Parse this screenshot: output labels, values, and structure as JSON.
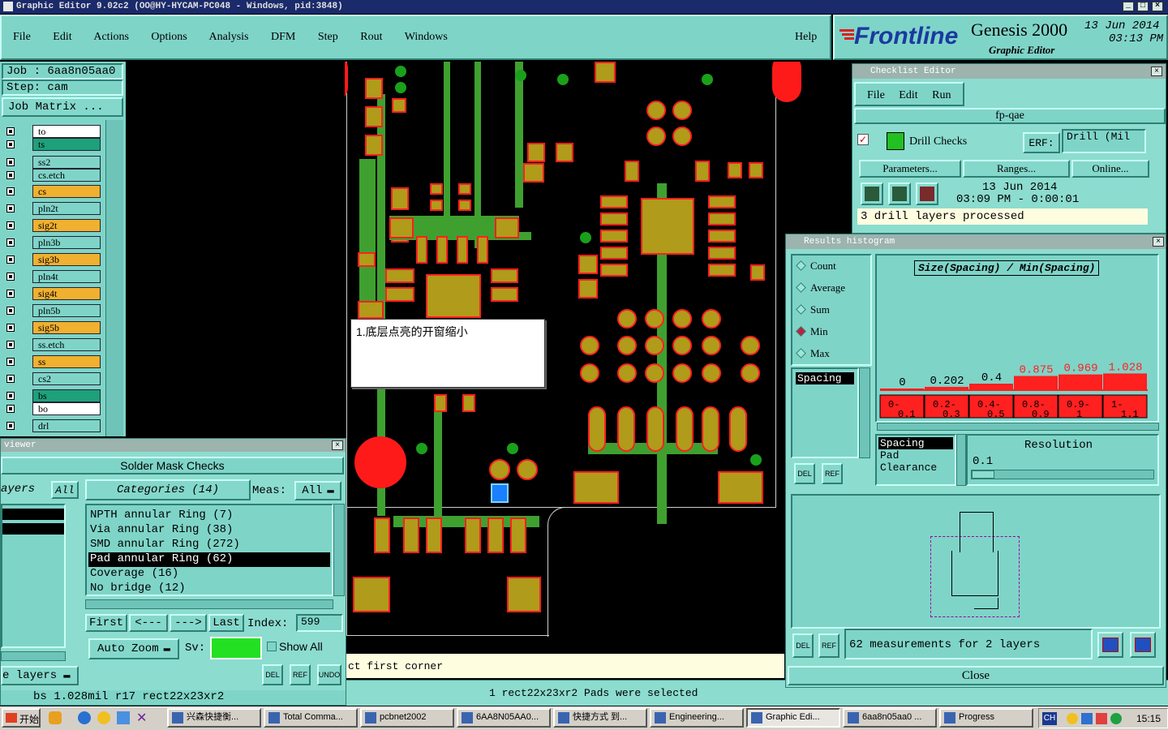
{
  "window_title": "Graphic Editor 9.02c2 (OO@HY-HYCAM-PC048 - Windows, pid:3848)",
  "menu": [
    "File",
    "Edit",
    "Actions",
    "Options",
    "Analysis",
    "DFM",
    "Step",
    "Rout",
    "Windows"
  ],
  "help_label": "Help",
  "brand": {
    "logo": "Frontline",
    "product": "Genesis 2000",
    "subtitle": "Graphic Editor",
    "date": "13 Jun 2014",
    "time": "03:13 PM"
  },
  "job": {
    "job_label": "Job : 6aa8n05aa0",
    "step_label": "Step: cam",
    "job_matrix": "Job Matrix ..."
  },
  "layers": [
    {
      "name": "to",
      "bg": "#ffffff"
    },
    {
      "name": "ts",
      "bg": "#1ea07a"
    },
    {
      "name": "ss2",
      "bg": "#7fd4c8"
    },
    {
      "name": "cs.etch",
      "bg": "#7fd4c8"
    },
    {
      "name": "cs",
      "bg": "#f0b030"
    },
    {
      "name": "pln2t",
      "bg": "#7fd4c8"
    },
    {
      "name": "sig2t",
      "bg": "#f0b030"
    },
    {
      "name": "pln3b",
      "bg": "#7fd4c8"
    },
    {
      "name": "sig3b",
      "bg": "#f0b030"
    },
    {
      "name": "pln4t",
      "bg": "#7fd4c8"
    },
    {
      "name": "sig4t",
      "bg": "#f0b030"
    },
    {
      "name": "pln5b",
      "bg": "#7fd4c8"
    },
    {
      "name": "sig5b",
      "bg": "#f0b030"
    },
    {
      "name": "ss.etch",
      "bg": "#7fd4c8"
    },
    {
      "name": "ss",
      "bg": "#f0b030"
    },
    {
      "name": "cs2",
      "bg": "#7fd4c8"
    },
    {
      "name": "bs",
      "bg": "#1ea07a"
    },
    {
      "name": "bo",
      "bg": "#ffffff"
    },
    {
      "name": "drl",
      "bg": "#7fd4c8"
    }
  ],
  "viewer": {
    "title": "viewer",
    "heading": "Solder Mask Checks",
    "layers_label": "ayers",
    "all_btn": "All",
    "categories_label": "Categories (14)",
    "meas_label": "Meas:",
    "meas_value": "All",
    "categories": [
      "NPTH annular Ring (7)",
      "Via annular Ring (38)",
      "SMD annular Ring (272)",
      "Pad annular Ring (62)",
      "Coverage (16)",
      "No bridge (12)"
    ],
    "selected_index": 3,
    "first": "First",
    "prev": "<---",
    "next": "--->",
    "last": "Last",
    "index_label": "Index:",
    "index_value": "599",
    "auto_zoom": "Auto Zoom",
    "sv_label": "Sv:",
    "show_all": "Show All",
    "e_layers": "e layers",
    "status": "bs 1.028mil  r17  rect22x23xr2"
  },
  "annotation": "1.底层点亮的开窗缩小",
  "prompt_text": "ct first corner",
  "selection_text": "1 rect22x23xr2 Pads were selected",
  "checklist": {
    "title": "Checklist Editor",
    "menu": [
      "File",
      "Edit",
      "Run"
    ],
    "name": "fp-qae",
    "check_name": "Drill Checks",
    "erf_label": "ERF:",
    "erf_value": "Drill (Mil",
    "parameters": "Parameters...",
    "ranges": "Ranges...",
    "online": "Online...",
    "run_date": "13 Jun 2014",
    "run_time": "03:09 PM - 0:00:01",
    "message": "3 drill layers processed"
  },
  "histogram": {
    "title": "Results histogram",
    "options": [
      "Count",
      "Average",
      "Sum",
      "Min",
      "Max"
    ],
    "selected_option": "Min",
    "chart_title": "Size(Spacing) / Min(Spacing)",
    "list_item": "Spacing",
    "types": [
      "Spacing",
      "Pad",
      "Clearance"
    ],
    "resolution_label": "Resolution",
    "resolution_value": "0.1",
    "summary": "62 measurements for 2 layers",
    "close": "Close",
    "del": "DEL",
    "ref": "REF"
  },
  "chart_data": {
    "type": "bar",
    "title": "Size(Spacing) / Min(Spacing)",
    "categories": [
      "0-0.1",
      "0.2-0.3",
      "0.4-0.5",
      "0.8-0.9",
      "0.9-1",
      "1-1.1"
    ],
    "values": [
      0,
      0.202,
      0.4,
      0.875,
      0.969,
      1.028
    ],
    "value_labels": [
      "0",
      "0.202",
      "0.4",
      "0.875",
      "0.969",
      "1.028"
    ],
    "category_labels_top": [
      "0-",
      "0.2-",
      "0.4-",
      "0.8-",
      "0.9-",
      "1-"
    ],
    "category_labels_bottom": [
      "0.1",
      "0.3",
      "0.5",
      "0.9",
      "1",
      "1.1"
    ],
    "ylim": [
      0,
      1.1
    ],
    "bar_color": "#ff2020"
  },
  "taskbar": {
    "start": "开始",
    "items": [
      "兴森快捷衡...",
      "Total Comma...",
      "pcbnet2002",
      "6AA8N05AA0...",
      "快捷方式 到...",
      "Engineering...",
      "Graphic Edi...",
      "6aa8n05aa0 ...",
      "Progress"
    ],
    "lang": "CH",
    "clock": "15:15"
  }
}
